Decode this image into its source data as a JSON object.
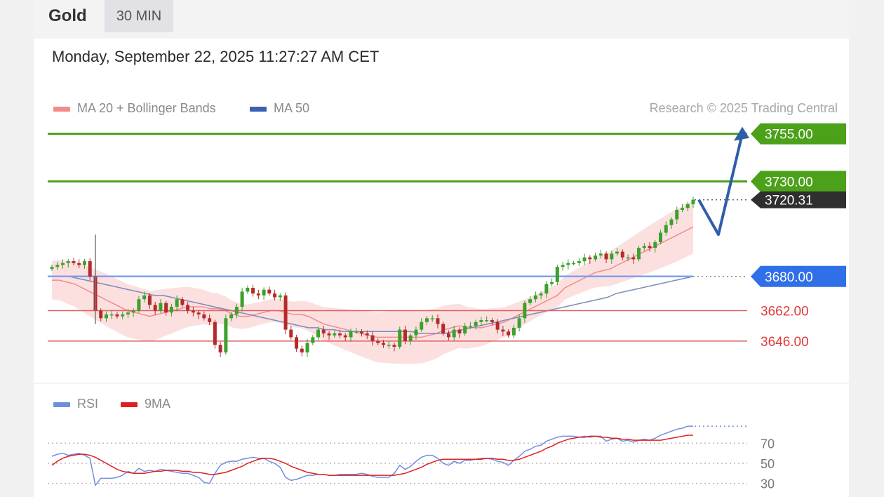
{
  "header": {
    "symbol": "Gold",
    "timeframe": "30 MIN"
  },
  "timestamp": "Monday, September 22, 2025 11:27:27 AM CET",
  "legend": {
    "ma20": {
      "label": "MA 20 + Bollinger Bands",
      "color": "#f28b8b"
    },
    "ma50": {
      "label": "MA 50",
      "color": "#3a62b0"
    }
  },
  "copyright": "Research © 2025 Trading Central",
  "rsi_legend": {
    "rsi": {
      "label": "RSI",
      "color": "#6e8fe0"
    },
    "ma9": {
      "label": "9MA",
      "color": "#e02020"
    }
  },
  "colors": {
    "bull": "#3aa12a",
    "bear": "#b52a2a",
    "resistance": "#4ca11a",
    "pivot": "#2f6fe8",
    "support": "#e06060",
    "last": "#2f2f2f",
    "arrow": "#2e5ea8"
  },
  "chart_data": [
    {
      "type": "candlestick",
      "ylim": [
        3626,
        3770
      ],
      "levels": [
        {
          "kind": "resistance",
          "label": "3755.00",
          "value": 3755
        },
        {
          "kind": "resistance",
          "label": "3730.00",
          "value": 3730
        },
        {
          "kind": "last",
          "label": "3720.31",
          "value": 3720.31
        },
        {
          "kind": "pivot",
          "label": "3680.00",
          "value": 3680
        },
        {
          "kind": "support",
          "label": "3662.00",
          "value": 3662
        },
        {
          "kind": "support",
          "label": "3646.00",
          "value": 3646
        }
      ],
      "projection": [
        3720.31,
        3702,
        3755
      ],
      "close": [
        3685,
        3686,
        3687,
        3688,
        3687,
        3686,
        3688,
        3680,
        3662,
        3658,
        3660,
        3660,
        3659,
        3660,
        3661,
        3662,
        3668,
        3670,
        3665,
        3662,
        3666,
        3661,
        3664,
        3668,
        3665,
        3662,
        3661,
        3660,
        3658,
        3656,
        3644,
        3640,
        3658,
        3660,
        3664,
        3672,
        3674,
        3671,
        3670,
        3673,
        3671,
        3669,
        3670,
        3652,
        3648,
        3642,
        3640,
        3645,
        3648,
        3652,
        3650,
        3649,
        3650,
        3649,
        3648,
        3651,
        3651,
        3650,
        3649,
        3646,
        3645,
        3644,
        3644,
        3643,
        3652,
        3646,
        3649,
        3652,
        3656,
        3658,
        3658,
        3655,
        3650,
        3648,
        3652,
        3650,
        3654,
        3654,
        3656,
        3657,
        3657,
        3656,
        3652,
        3651,
        3649,
        3653,
        3658,
        3666,
        3668,
        3670,
        3671,
        3676,
        3677,
        3685,
        3686,
        3687,
        3687,
        3688,
        3690,
        3689,
        3691,
        3692,
        3689,
        3692,
        3693,
        3690,
        3690,
        3689,
        3695,
        3696,
        3695,
        3698,
        3703,
        3707,
        3710,
        3715,
        3716,
        3718,
        3720.31
      ],
      "ma20": [
        3678,
        3678,
        3677,
        3676,
        3674,
        3672,
        3670,
        3668,
        3666,
        3664,
        3662,
        3661,
        3660,
        3659,
        3660,
        3661,
        3662,
        3663,
        3664,
        3664,
        3664,
        3663,
        3663,
        3662,
        3660,
        3659,
        3659,
        3660,
        3661,
        3662,
        3662,
        3661,
        3660,
        3660,
        3659,
        3657,
        3655,
        3654,
        3653,
        3652,
        3651,
        3650,
        3649,
        3648,
        3648,
        3648,
        3648,
        3648,
        3648,
        3648,
        3649,
        3650,
        3652,
        3653,
        3654,
        3653,
        3653,
        3653,
        3654,
        3655,
        3656,
        3658,
        3660,
        3662,
        3664,
        3666,
        3668,
        3670,
        3674,
        3676,
        3678,
        3680,
        3682,
        3683,
        3684,
        3686,
        3688,
        3690,
        3692,
        3694,
        3696,
        3698,
        3700,
        3702,
        3704,
        3706
      ],
      "ma50": [
        3680,
        3680,
        3680,
        3679,
        3678,
        3677,
        3676,
        3675,
        3674,
        3673,
        3672,
        3671,
        3670,
        3670,
        3669,
        3668,
        3667,
        3666,
        3665,
        3664,
        3663,
        3662,
        3661,
        3660,
        3659,
        3658,
        3657,
        3656,
        3655,
        3654,
        3653,
        3653,
        3652,
        3652,
        3651,
        3651,
        3651,
        3651,
        3651,
        3651,
        3651,
        3651,
        3651,
        3650,
        3650,
        3650,
        3650,
        3651,
        3652,
        3653,
        3654,
        3655,
        3656,
        3657,
        3658,
        3659,
        3660,
        3661,
        3662,
        3663,
        3664,
        3665,
        3666,
        3667,
        3668,
        3669,
        3671,
        3672,
        3673,
        3674,
        3675,
        3676,
        3677,
        3678,
        3679,
        3680
      ]
    },
    {
      "type": "line",
      "ylim": [
        22,
        92
      ],
      "ticks": [
        "70",
        "50",
        "30"
      ],
      "series": [
        {
          "name": "RSI",
          "values": [
            57,
            59,
            60,
            58,
            59,
            60,
            58,
            55,
            28,
            35,
            35,
            35,
            36,
            38,
            42,
            40,
            45,
            42,
            43,
            42,
            44,
            43,
            42,
            41,
            40,
            40,
            38,
            36,
            31,
            30,
            40,
            48,
            51,
            52,
            52,
            54,
            55,
            56,
            55,
            55,
            52,
            50,
            46,
            36,
            33,
            34,
            36,
            38,
            38,
            39,
            39,
            38,
            38,
            39,
            39,
            39,
            39,
            40,
            39,
            37,
            36,
            36,
            36,
            40,
            48,
            44,
            47,
            52,
            56,
            58,
            58,
            55,
            50,
            48,
            52,
            50,
            53,
            53,
            54,
            55,
            55,
            54,
            52,
            51,
            48,
            53,
            57,
            62,
            64,
            67,
            68,
            72,
            74,
            76,
            77,
            77,
            77,
            76,
            77,
            76,
            77,
            77,
            72,
            74,
            75,
            72,
            73,
            71,
            73,
            74,
            73,
            75,
            78,
            80,
            82,
            84,
            85,
            87,
            87
          ]
        },
        {
          "name": "9MA",
          "values": [
            48,
            52,
            55,
            57,
            58,
            59,
            59,
            58,
            56,
            53,
            50,
            47,
            44,
            42,
            41,
            40,
            40,
            40,
            41,
            42,
            42,
            43,
            43,
            43,
            42,
            42,
            41,
            41,
            40,
            39,
            39,
            40,
            41,
            43,
            45,
            47,
            50,
            52,
            54,
            55,
            55,
            54,
            52,
            50,
            47,
            45,
            43,
            41,
            40,
            39,
            39,
            38,
            38,
            38,
            38,
            38,
            38,
            38,
            38,
            38,
            38,
            38,
            38,
            38,
            39,
            40,
            42,
            44,
            46,
            49,
            51,
            53,
            54,
            54,
            54,
            54,
            54,
            54,
            54,
            54,
            55,
            55,
            54,
            54,
            53,
            53,
            54,
            56,
            58,
            60,
            62,
            65,
            67,
            70,
            72,
            74,
            75,
            76,
            76,
            77,
            77,
            76,
            76,
            75,
            75,
            74,
            74,
            73,
            73,
            73,
            73,
            73,
            73,
            74,
            75,
            76,
            77,
            78,
            78
          ]
        }
      ]
    }
  ]
}
